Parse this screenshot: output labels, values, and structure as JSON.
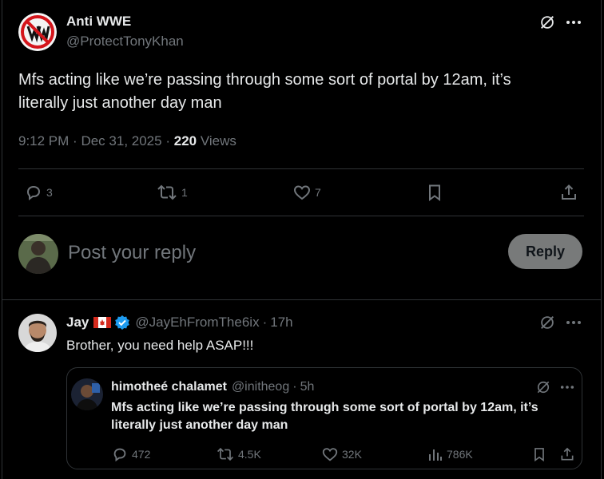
{
  "post": {
    "display_name": "Anti WWE",
    "handle": "@ProtectTonyKhan",
    "text_line1": "Mfs acting like we’re passing through some sort of portal by 12am, it’s",
    "text_line2": "literally just another day man",
    "time": "9:12 PM",
    "sep1": "·",
    "date": "Dec 31, 2025",
    "sep2": "·",
    "views_count": "220",
    "views_label": "Views",
    "reply_count": "3",
    "repost_count": "1",
    "like_count": "7"
  },
  "composer": {
    "placeholder": "Post your reply",
    "button_label": "Reply"
  },
  "reply": {
    "display_name": "Jay",
    "flag": "🇨🇦",
    "handle": "@JayEhFromThe6ix",
    "sep": "·",
    "time": "17h",
    "text": "Brother, you need help ASAP!!!"
  },
  "quoted": {
    "display_name": "himotheé chalamet",
    "handle": "@initheog",
    "sep": "·",
    "time": "5h",
    "text_line1": "Mfs acting like we’re passing through some sort of portal by 12am, it’s",
    "text_line2": "literally just another day man",
    "reply_count": "472",
    "repost_count": "4.5K",
    "like_count": "32K",
    "views_count": "786K"
  },
  "colors": {
    "background": "#000000",
    "text": "#e7e9ea",
    "muted": "#71767b",
    "border": "#2f3336",
    "verified": "#1d9bf0",
    "reply_button_bg": "#787a7a"
  },
  "icons": [
    "grok-icon",
    "more-icon",
    "reply-icon",
    "repost-icon",
    "like-icon",
    "bookmark-icon",
    "share-icon",
    "views-icon",
    "verified-badge-icon"
  ]
}
